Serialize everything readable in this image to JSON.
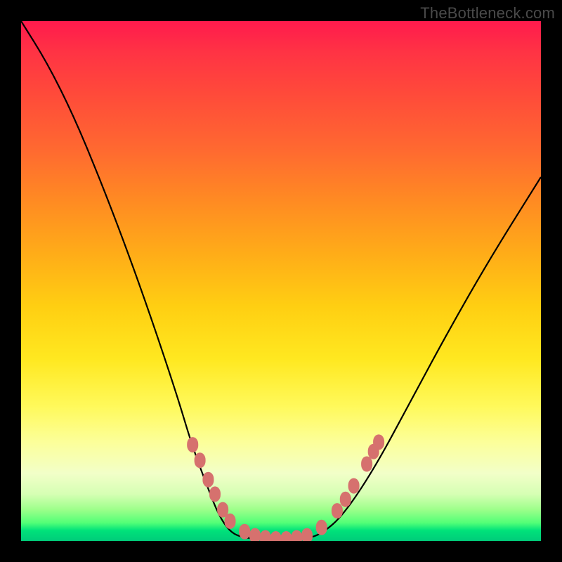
{
  "watermark": "TheBottleneck.com",
  "colors": {
    "gradient_top": "#ff1a4d",
    "gradient_bottom": "#00cc7a",
    "curve_stroke": "#000000",
    "marker_fill": "#d6716e",
    "plot_frame": "#000000"
  },
  "chart_data": {
    "type": "line",
    "title": "",
    "xlabel": "",
    "ylabel": "",
    "xlim": [
      0,
      100
    ],
    "ylim": [
      0,
      100
    ],
    "series": [
      {
        "name": "bottleneck-curve",
        "x": [
          0,
          5,
          10,
          15,
          20,
          25,
          30,
          33,
          36,
          38,
          40,
          42,
          45,
          50,
          55,
          58,
          62,
          68,
          75,
          82,
          90,
          100
        ],
        "y": [
          100,
          92,
          82,
          70,
          57,
          43,
          28,
          18,
          10,
          5,
          2,
          0.8,
          0.4,
          0.2,
          0.4,
          1.5,
          5,
          14,
          27,
          40,
          54,
          70
        ]
      }
    ],
    "markers": {
      "name": "highlighted-points",
      "shape": "rounded",
      "points": [
        {
          "x": 33.0,
          "y": 18.5
        },
        {
          "x": 34.4,
          "y": 15.5
        },
        {
          "x": 36.0,
          "y": 11.8
        },
        {
          "x": 37.3,
          "y": 9.0
        },
        {
          "x": 38.8,
          "y": 6.0
        },
        {
          "x": 40.2,
          "y": 3.8
        },
        {
          "x": 43.0,
          "y": 1.8
        },
        {
          "x": 45.0,
          "y": 1.0
        },
        {
          "x": 47.0,
          "y": 0.6
        },
        {
          "x": 49.0,
          "y": 0.4
        },
        {
          "x": 51.0,
          "y": 0.4
        },
        {
          "x": 53.0,
          "y": 0.6
        },
        {
          "x": 55.0,
          "y": 1.0
        },
        {
          "x": 57.8,
          "y": 2.6
        },
        {
          "x": 60.8,
          "y": 5.8
        },
        {
          "x": 62.4,
          "y": 8.0
        },
        {
          "x": 64.0,
          "y": 10.6
        },
        {
          "x": 66.5,
          "y": 14.8
        },
        {
          "x": 67.8,
          "y": 17.2
        },
        {
          "x": 68.8,
          "y": 19.0
        }
      ]
    }
  }
}
